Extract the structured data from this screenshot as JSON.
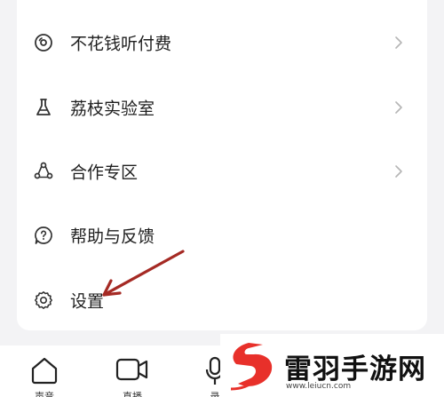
{
  "menu": {
    "items": [
      {
        "label": "不花钱听付费",
        "icon": "disc-icon",
        "has_chevron": true
      },
      {
        "label": "荔枝实验室",
        "icon": "flask-icon",
        "has_chevron": true
      },
      {
        "label": "合作专区",
        "icon": "cooperation-icon",
        "has_chevron": true
      },
      {
        "label": "帮助与反馈",
        "icon": "help-icon",
        "has_chevron": false
      },
      {
        "label": "设置",
        "icon": "gear-icon",
        "has_chevron": false
      }
    ]
  },
  "tabbar": {
    "tabs": [
      {
        "label": "声音",
        "icon": "home-icon"
      },
      {
        "label": "直播",
        "icon": "live-camera-icon"
      },
      {
        "label": "录",
        "icon": "microphone-icon"
      }
    ]
  },
  "watermark": {
    "text": "雷羽手游网",
    "url": "www.leiucn.com",
    "brand_color": "#e8302a"
  },
  "annotation": {
    "color": "#a52a24"
  }
}
